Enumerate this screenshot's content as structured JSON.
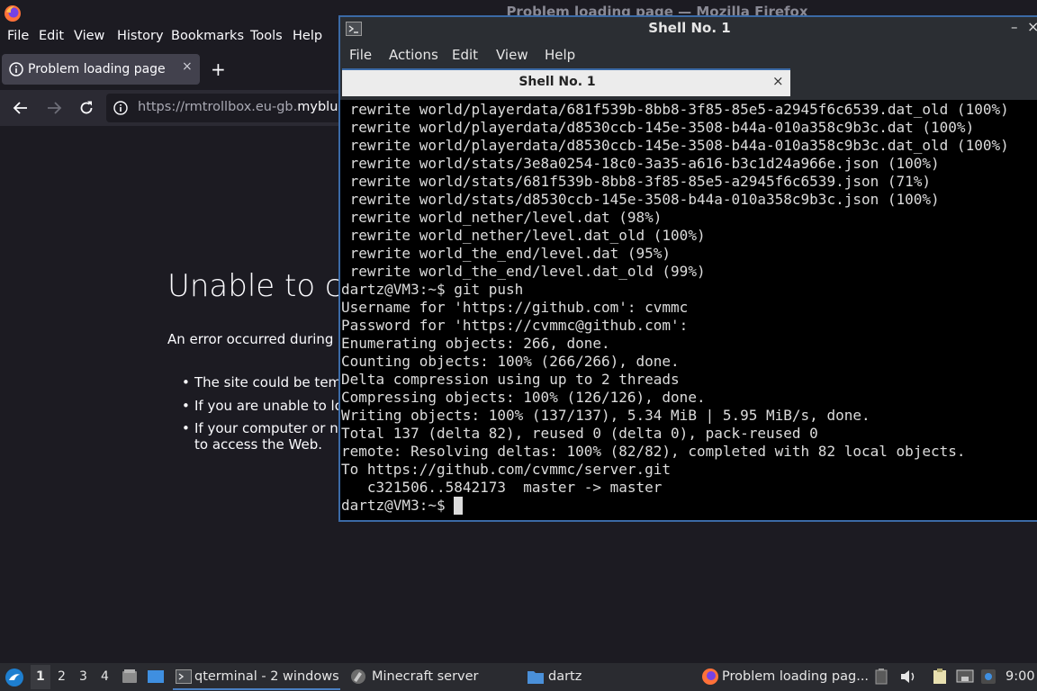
{
  "firefox": {
    "window_title": "Problem loading page — Mozilla Firefox",
    "menu": [
      "File",
      "Edit",
      "View",
      "History",
      "Bookmarks",
      "Tools",
      "Help"
    ],
    "tab_title": "Problem loading page",
    "tab_close": "×",
    "new_tab": "+",
    "url_prefix": "https://rmtrollbox.eu-gb.",
    "url_domain": "myblue",
    "error_title": "Unable to c",
    "error_desc": "An error occurred during",
    "bullets": [
      "The site could be tem",
      "If you are unable to lo",
      "If your computer or n"
    ],
    "bullet_tail": "to access the Web."
  },
  "terminal": {
    "title": "Shell No. 1",
    "menu": [
      "File",
      "Actions",
      "Edit",
      "View",
      "Help"
    ],
    "tab_label": "Shell No. 1",
    "tab_close": "×",
    "minimize": "–",
    "close": "×",
    "lines": [
      " rewrite world/playerdata/681f539b-8bb8-3f85-85e5-a2945f6c6539.dat_old (100%)",
      " rewrite world/playerdata/d8530ccb-145e-3508-b44a-010a358c9b3c.dat (100%)",
      " rewrite world/playerdata/d8530ccb-145e-3508-b44a-010a358c9b3c.dat_old (100%)",
      " rewrite world/stats/3e8a0254-18c0-3a35-a616-b3c1d24a966e.json (100%)",
      " rewrite world/stats/681f539b-8bb8-3f85-85e5-a2945f6c6539.json (71%)",
      " rewrite world/stats/d8530ccb-145e-3508-b44a-010a358c9b3c.json (100%)",
      " rewrite world_nether/level.dat (98%)",
      " rewrite world_nether/level.dat_old (100%)",
      " rewrite world_the_end/level.dat (95%)",
      " rewrite world_the_end/level.dat_old (99%)",
      "dartz@VM3:~$ git push",
      "Username for 'https://github.com': cvmmc",
      "Password for 'https://cvmmc@github.com':",
      "Enumerating objects: 266, done.",
      "Counting objects: 100% (266/266), done.",
      "Delta compression using up to 2 threads",
      "Compressing objects: 100% (126/126), done.",
      "Writing objects: 100% (137/137), 5.34 MiB | 5.95 MiB/s, done.",
      "Total 137 (delta 82), reused 0 (delta 0), pack-reused 0",
      "remote: Resolving deltas: 100% (82/82), completed with 82 local objects.",
      "To https://github.com/cvmmc/server.git",
      "   c321506..5842173  master -> master",
      "dartz@VM3:~$ "
    ]
  },
  "taskbar": {
    "workspaces": [
      "1",
      "2",
      "3",
      "4"
    ],
    "tasks": [
      "qterminal - 2 windows",
      "Minecraft server",
      "dartz",
      "Problem loading pag..."
    ],
    "clock": "9:00"
  },
  "colors": {
    "accent": "#3b6aa6",
    "firefox_bg": "#1c1b22",
    "terminal_bg": "#000000",
    "taskbar_bg": "#2a2b30"
  }
}
